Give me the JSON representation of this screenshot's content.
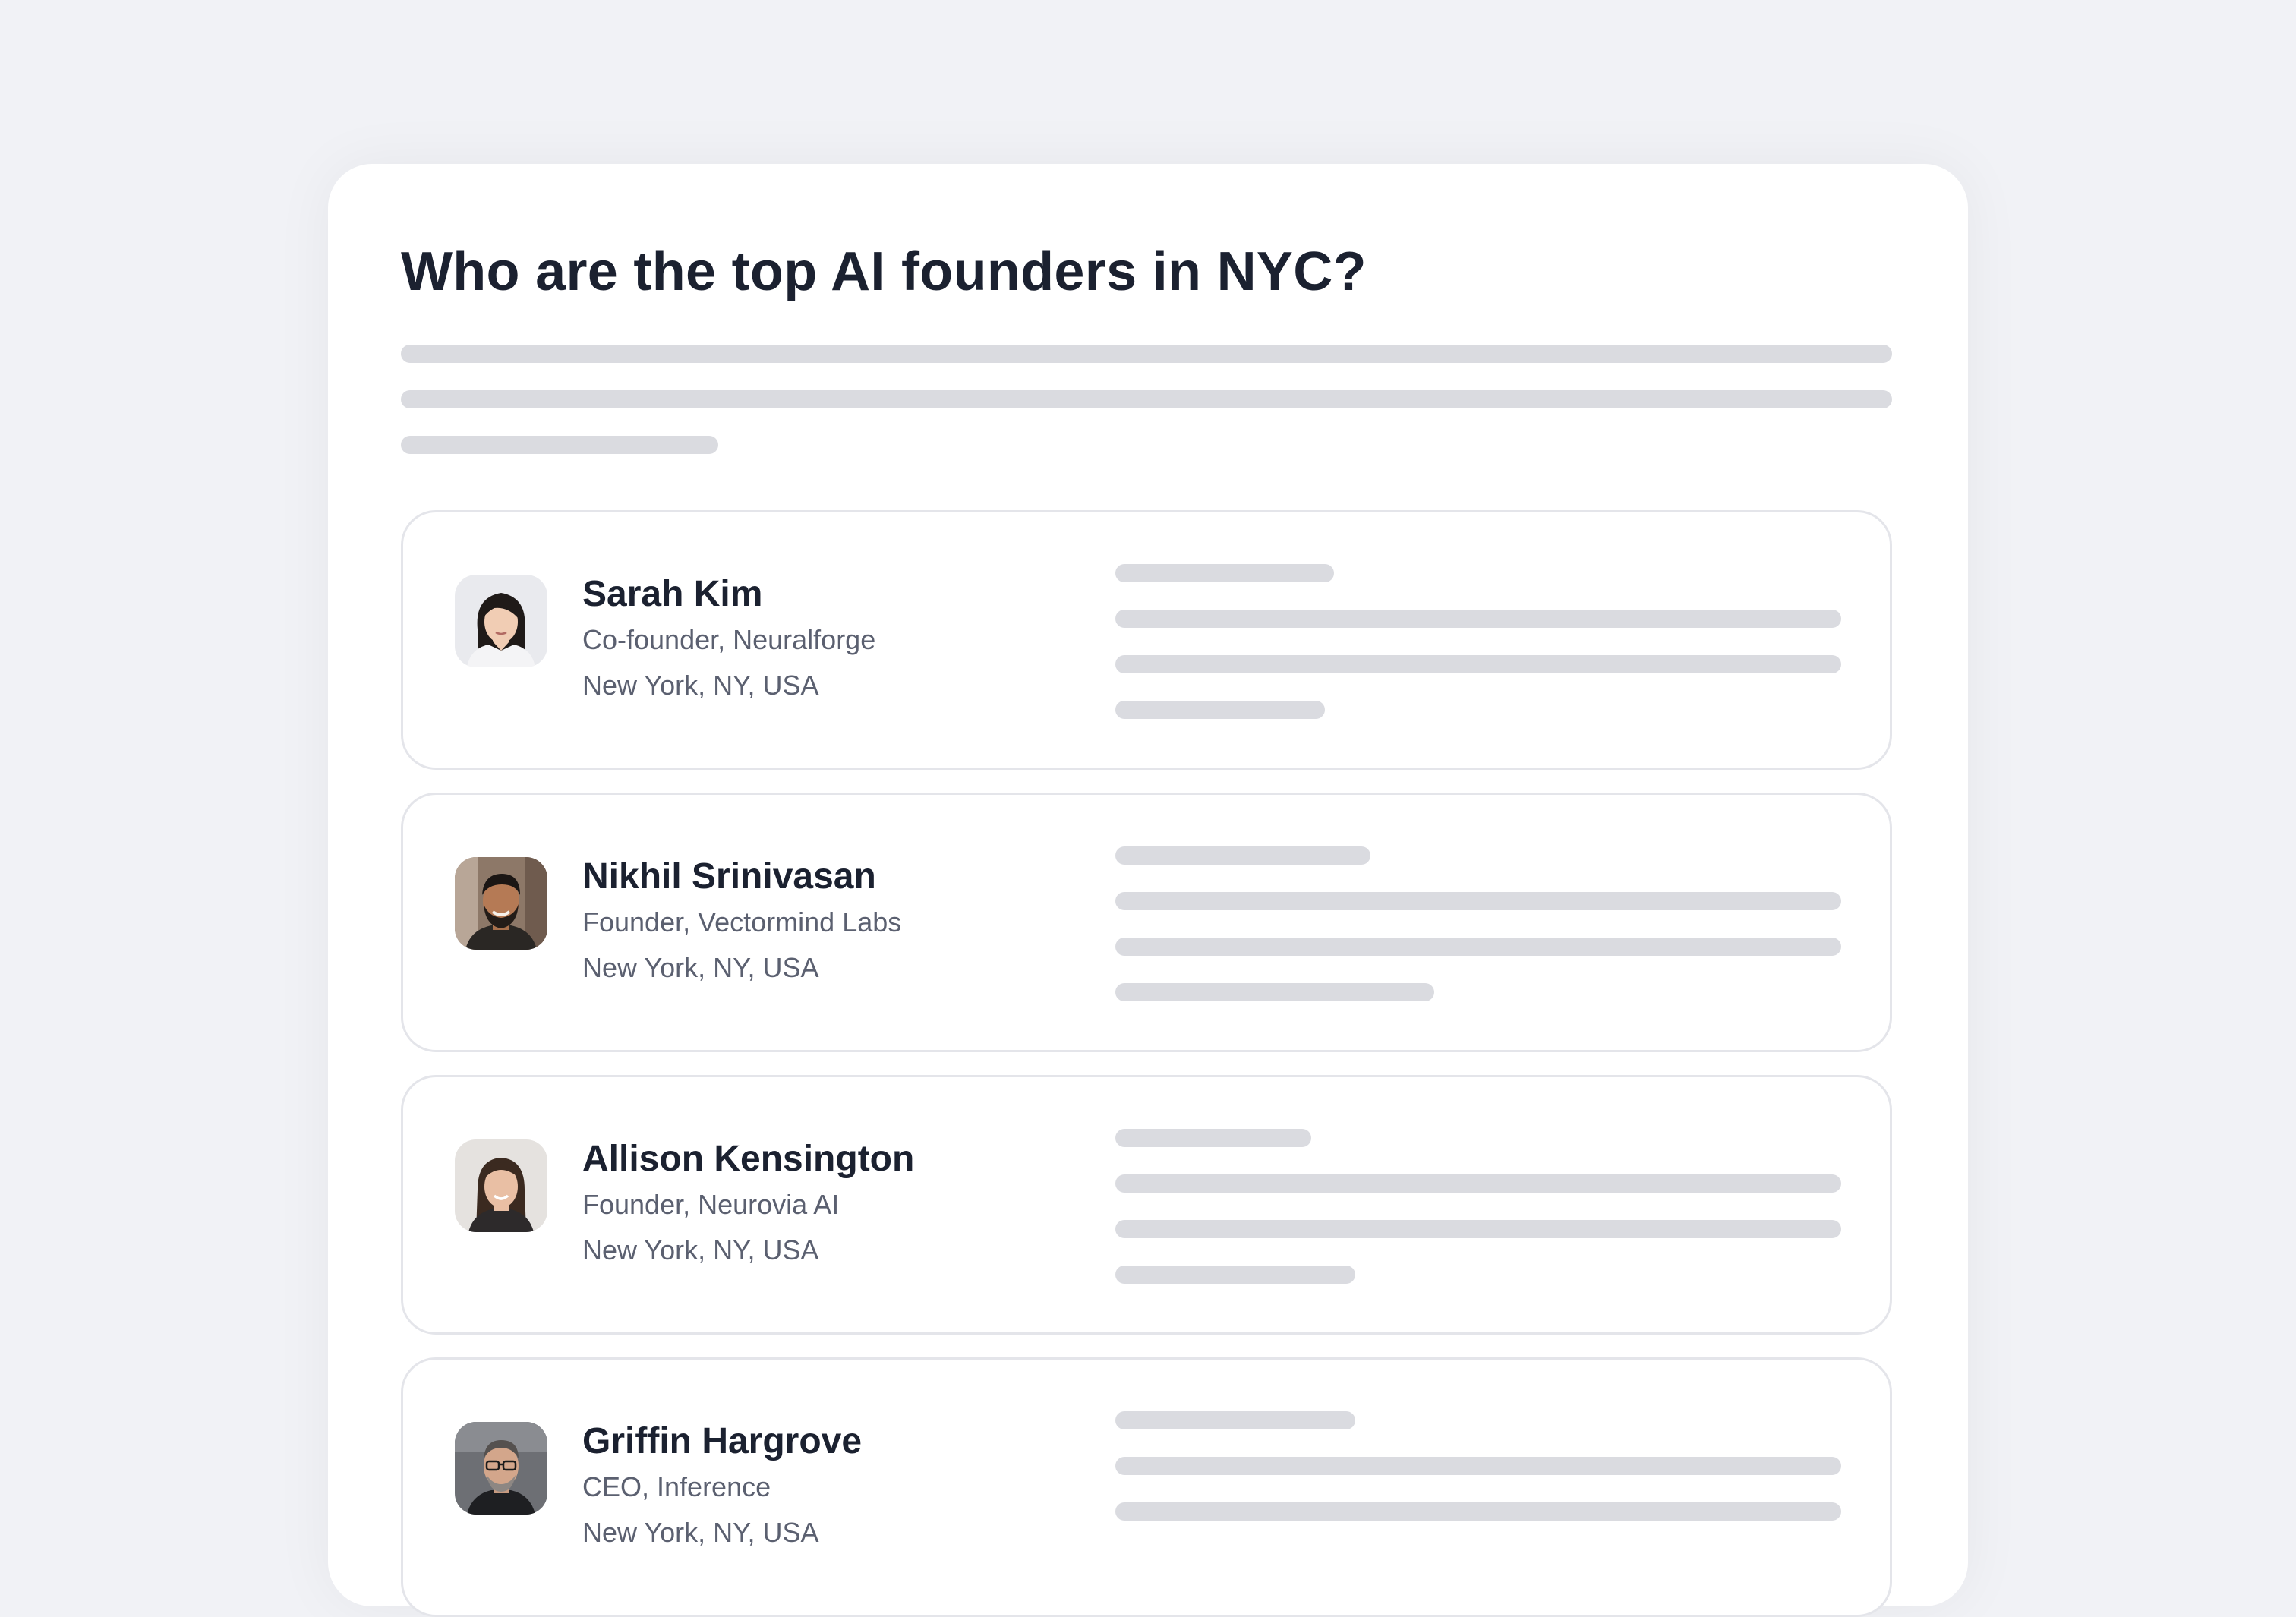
{
  "query": {
    "title": "Who are the top AI founders in NYC?"
  },
  "results": [
    {
      "name": "Sarah Kim",
      "role": "Co-founder, Neuralforge",
      "location": "New York, NY, USA",
      "avatar_icon": "woman-portrait"
    },
    {
      "name": "Nikhil Srinivasan",
      "role": "Founder, Vectormind Labs",
      "location": "New York, NY, USA",
      "avatar_icon": "man-bearded-portrait"
    },
    {
      "name": "Allison Kensington",
      "role": "Founder, Neurovia AI",
      "location": "New York, NY, USA",
      "avatar_icon": "woman-portrait"
    },
    {
      "name": "Griffin Hargrove",
      "role": "CEO, Inference",
      "location": "New York, NY, USA",
      "avatar_icon": "man-glasses-portrait"
    }
  ],
  "colors": {
    "background": "#f1f2f6",
    "panel": "#ffffff",
    "skeleton": "#dadbe0",
    "card_border": "#e4e5ea",
    "heading_text": "#1b2130",
    "secondary_text": "#5b6070"
  }
}
